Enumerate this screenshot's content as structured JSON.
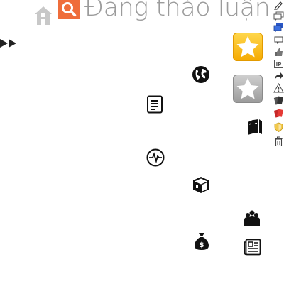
{
  "header": {
    "title": "Đang thảo luận",
    "search_color": "#ef6d3b"
  },
  "icons": {
    "home": "home-icon",
    "search": "search-icon",
    "fast_forward": "fast-forward-icon",
    "favorite_on": "star-icon",
    "favorite_off": "star-icon",
    "globe": "globe-icon",
    "document": "document-icon",
    "books": "books-icon",
    "activity": "activity-icon",
    "box": "box-icon",
    "community": "community-icon",
    "money": "money-bag-icon",
    "newspaper": "newspaper-icon"
  },
  "toolbar": {
    "items": [
      {
        "name": "edit-icon"
      },
      {
        "name": "comments-icon"
      },
      {
        "name": "chat-icon"
      },
      {
        "name": "speech-bubble-icon"
      },
      {
        "name": "thumbs-up-icon"
      },
      {
        "name": "ip-icon",
        "label": "IP"
      },
      {
        "name": "share-icon"
      },
      {
        "name": "warning-icon"
      },
      {
        "name": "cards-icon"
      },
      {
        "name": "red-card-icon"
      },
      {
        "name": "shield-icon"
      },
      {
        "name": "trash-icon"
      }
    ]
  }
}
